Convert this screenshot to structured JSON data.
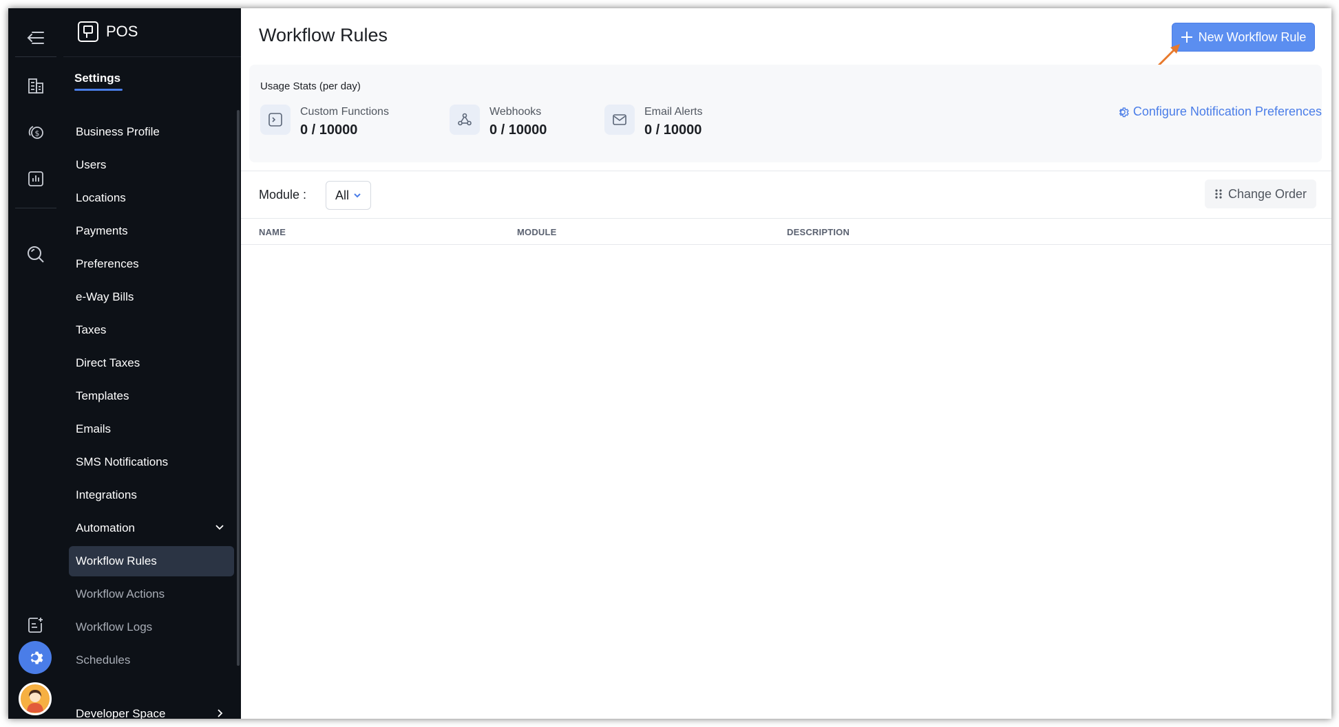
{
  "app": {
    "name": "POS"
  },
  "panel": {
    "title": "Settings",
    "items": [
      {
        "label": "Business Profile"
      },
      {
        "label": "Users"
      },
      {
        "label": "Locations"
      },
      {
        "label": "Payments"
      },
      {
        "label": "Preferences"
      },
      {
        "label": "e-Way Bills"
      },
      {
        "label": "Taxes"
      },
      {
        "label": "Direct Taxes"
      },
      {
        "label": "Templates"
      },
      {
        "label": "Emails"
      },
      {
        "label": "SMS Notifications"
      },
      {
        "label": "Integrations"
      },
      {
        "label": "Automation"
      },
      {
        "label": "Workflow Rules"
      },
      {
        "label": "Workflow Actions"
      },
      {
        "label": "Workflow Logs"
      },
      {
        "label": "Schedules"
      },
      {
        "label": "Developer Space"
      }
    ]
  },
  "rail": {
    "icons": [
      "collapse-menu-icon",
      "business-icon",
      "finance-icon",
      "reports-icon",
      "search-icon",
      "notes-icon",
      "settings-gear-icon",
      "user-avatar"
    ]
  },
  "header": {
    "title": "Workflow Rules",
    "new_button_label": "New Workflow Rule"
  },
  "usage": {
    "label": "Usage Stats (per day)",
    "stats": [
      {
        "name": "Custom Functions",
        "value": "0 / 10000",
        "icon": "terminal-icon"
      },
      {
        "name": "Webhooks",
        "value": "0 / 10000",
        "icon": "webhook-icon"
      },
      {
        "name": "Email Alerts",
        "value": "0 / 10000",
        "icon": "mail-icon"
      }
    ],
    "config_link": "Configure Notification Preferences"
  },
  "filter": {
    "module_label": "Module :",
    "module_value": "All",
    "change_order_label": "Change Order"
  },
  "table": {
    "columns": [
      "NAME",
      "MODULE",
      "DESCRIPTION"
    ],
    "rows": []
  },
  "colors": {
    "sidebar_bg": "#0d1117",
    "accent": "#5b8ef0",
    "active_item_bg": "#2b3444",
    "annotation_arrow": "#e8792b"
  }
}
